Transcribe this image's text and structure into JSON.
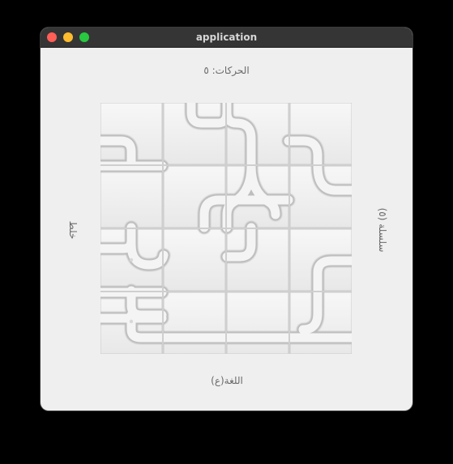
{
  "window": {
    "title": "application",
    "controls": [
      "close",
      "minimize",
      "zoom"
    ]
  },
  "header": {
    "moves_label": "الحركات: ٥"
  },
  "sidebar": {
    "left_label": "خلط",
    "right_label": "سلسلة (٥)"
  },
  "footer": {
    "language_button": "اللغة(ع)"
  },
  "board": {
    "grid_size": 4,
    "tile_color": "#f3f3f3",
    "groove_color": "#cfcfcf"
  }
}
